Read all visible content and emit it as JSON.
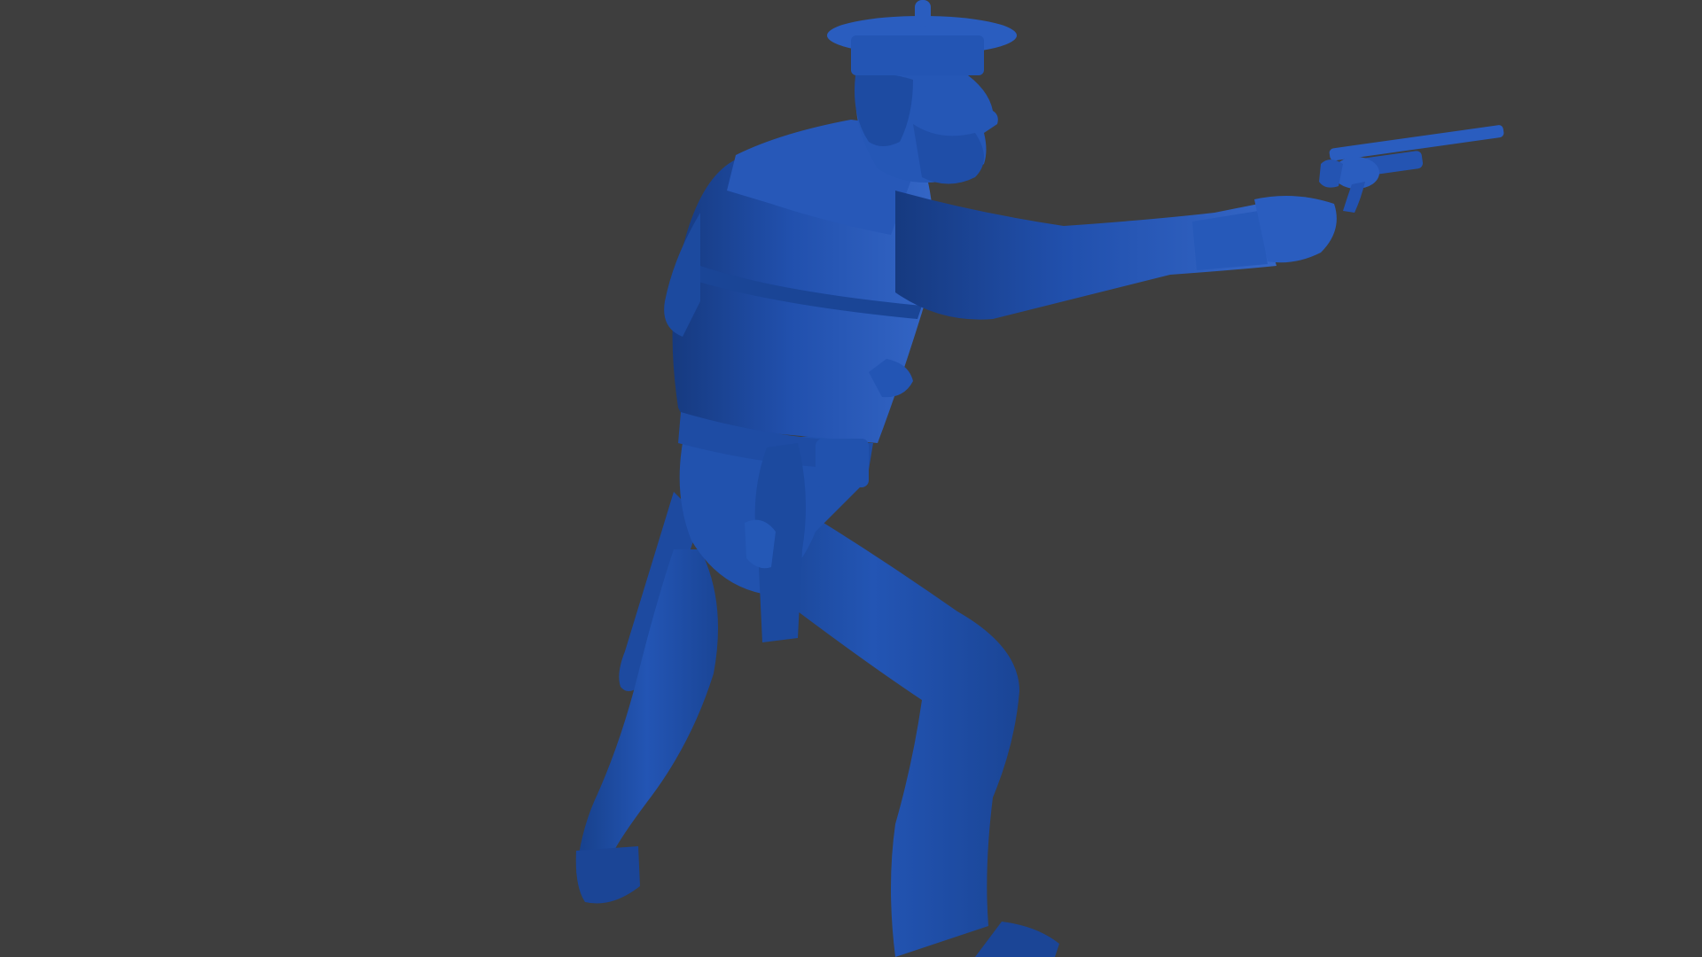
{
  "viewport": {
    "background_color": "#3e3e3e"
  },
  "model": {
    "subject": "sculpted-figure",
    "base_color": "#2150ad",
    "shadow_color": "#163a80",
    "highlight_color": "#3a6fd0"
  }
}
